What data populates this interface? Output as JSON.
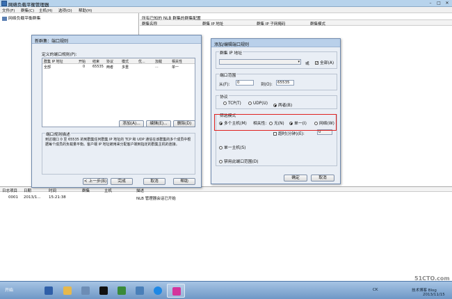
{
  "app": {
    "title": "网络负载平衡管理器"
  },
  "menu": [
    "文件(F)",
    "群集(C)",
    "主机(H)",
    "选项(O)",
    "帮助(H)"
  ],
  "tree": {
    "root": "网络负载平衡群集"
  },
  "right_pane": {
    "heading": "所有已知的 NLB 群集的群集配置",
    "columns": [
      "群集名称",
      "群集 IP 地址",
      "群集 IP 子网掩码",
      "群集模式"
    ]
  },
  "log": {
    "columns": [
      "日志项目",
      "日期",
      "时间",
      "群集",
      "主机",
      "描述"
    ],
    "rows": [
      {
        "item": "0001",
        "date": "2013/1...",
        "time": "15:21:38",
        "cluster": "",
        "host": "",
        "desc": "NLB 管理器会话已开始"
      }
    ]
  },
  "new_cluster_dialog": {
    "title": "新群集：端口规则",
    "defined_label": "定义的端口规则(P):",
    "columns": [
      "群集 IP 地址",
      "开始",
      "结束",
      "协议",
      "模式",
      "优...",
      "加载",
      "相关性"
    ],
    "rows": [
      {
        "ip": "全部",
        "start": "0",
        "end": "65535",
        "protocol": "两者",
        "mode": "多重",
        "priority": "",
        "load": "...",
        "affinity": "单一"
      }
    ],
    "buttons": {
      "add": "添加(A)...",
      "edit": "编辑(E)...",
      "delete": "删除(D)",
      "back": "< 上一步(B)",
      "finish": "完成",
      "cancel": "取消",
      "help": "帮助"
    },
    "desc_title": "端口规则描述",
    "desc_text": "到达端口 0 至 65535 的到群集任何群集 IP 地址的 TCP 和 UDP 通信在该群集的多个成员中根据每个成员的负载量平衡。客户端 IP 地址被用来分配客户端到指定的群集主机的连接。"
  },
  "edit_dialog": {
    "title": "添加/编辑端口规则",
    "cluster_ip_label": "群集 IP 地址",
    "or_label": "或",
    "all_label": "全部(A)",
    "all_checked": true,
    "port_range_label": "端口范围",
    "from_label": "从(F):",
    "from_value": "0",
    "to_label": "到(O):",
    "to_value": "65535",
    "protocol_label": "协议",
    "protocols": [
      {
        "label": "TCP(T)",
        "on": false
      },
      {
        "label": "UDP(U)",
        "on": false
      },
      {
        "label": "两者(B)",
        "on": true
      }
    ],
    "filter_label": "筛选模式",
    "multi_host": "多个主机(M)",
    "affinity_label": "相关性:",
    "affinities": [
      {
        "label": "无(N)",
        "on": false
      },
      {
        "label": "单一(I)",
        "on": true
      },
      {
        "label": "网络(W)",
        "on": false
      }
    ],
    "timeout_label": "超时(分钟)(E):",
    "timeout_value": "0",
    "single_host": "单一主机(S)",
    "disable": "禁用此端口范围(D)",
    "ok": "确定",
    "cancel": "取消",
    "highlight_color": "#e0201e"
  },
  "taskbar": {
    "start": "开始",
    "lang": "CK",
    "clock": "2013/11/15",
    "watermark": "51CTO.com",
    "watermark2": "技术博客 Blog"
  }
}
